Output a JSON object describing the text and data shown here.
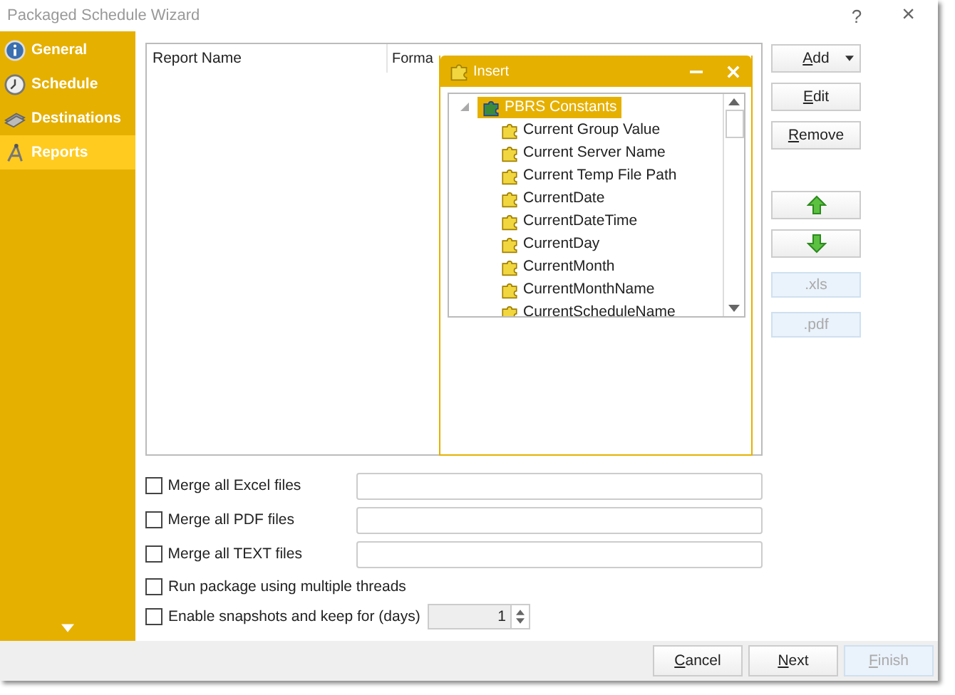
{
  "window": {
    "title": "Packaged Schedule Wizard",
    "help": "?",
    "close": "×"
  },
  "sidebar": {
    "items": [
      {
        "label": "General",
        "selected": false
      },
      {
        "label": "Schedule",
        "selected": false
      },
      {
        "label": "Destinations",
        "selected": false
      },
      {
        "label": "Reports",
        "selected": true
      }
    ]
  },
  "report_list": {
    "columns": [
      "Report Name",
      "Forma"
    ]
  },
  "insert_popup": {
    "title": "Insert",
    "tree": {
      "label": "PBRS Constants",
      "selected": true,
      "expanded": true,
      "children": [
        {
          "label": "Current Group Value"
        },
        {
          "label": "Current Server Name"
        },
        {
          "label": "Current Temp File Path"
        },
        {
          "label": "CurrentDate"
        },
        {
          "label": "CurrentDateTime"
        },
        {
          "label": "CurrentDay"
        },
        {
          "label": "CurrentMonth"
        },
        {
          "label": "CurrentMonthName"
        },
        {
          "label": "CurrentScheduleName"
        }
      ]
    }
  },
  "side_buttons": [
    {
      "kind": "split",
      "label": "Add",
      "disabled": false
    },
    {
      "kind": "text",
      "label": "Edit",
      "disabled": false
    },
    {
      "kind": "text",
      "label": "Remove",
      "disabled": false
    },
    {
      "kind": "up",
      "disabled": false
    },
    {
      "kind": "down",
      "disabled": false
    },
    {
      "kind": "text",
      "label": ".xls",
      "disabled": true
    },
    {
      "kind": "text",
      "label": ".pdf",
      "disabled": true
    }
  ],
  "options": [
    {
      "kind": "file",
      "label": "Merge all Excel files",
      "checked": false
    },
    {
      "kind": "file",
      "label": "Merge all PDF files",
      "checked": false
    },
    {
      "kind": "file",
      "label": "Merge all TEXT files",
      "checked": false
    },
    {
      "kind": "check",
      "label": "Run package using multiple threads",
      "checked": false
    },
    {
      "kind": "spin",
      "label": "Enable snapshots and keep for (days)",
      "checked": false,
      "value": "1"
    }
  ],
  "footer_buttons": [
    {
      "label": "Cancel",
      "disabled": false
    },
    {
      "label": "Next",
      "disabled": false
    },
    {
      "label": "Finish",
      "disabled": true
    }
  ]
}
